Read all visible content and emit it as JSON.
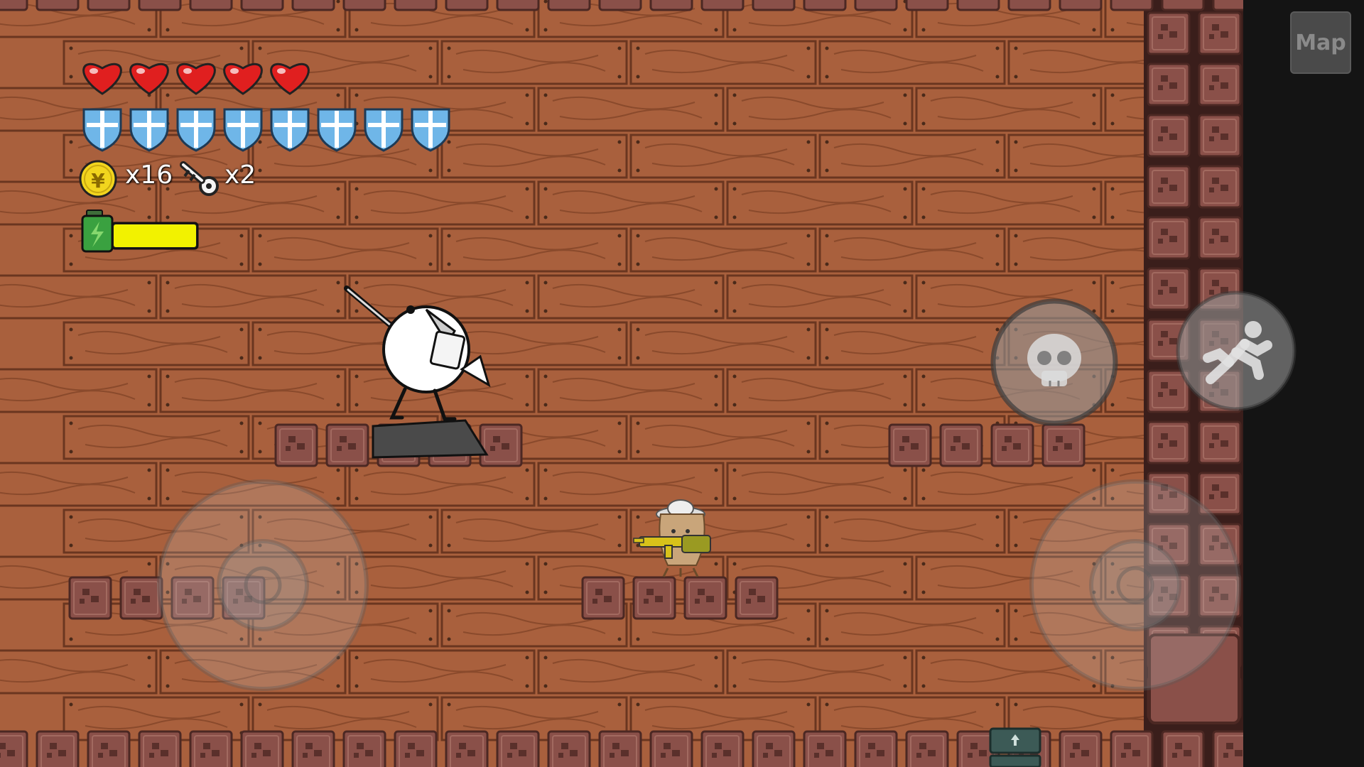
{
  "hud": {
    "hearts_filled": 5,
    "hearts_total": 5,
    "shields": 8,
    "coin_icon": "yen-coin-icon",
    "coin_count_label": "x16",
    "key_icon": "key-icon",
    "key_count_label": "x2",
    "energy_icon": "battery-icon",
    "energy_level": 1.0
  },
  "map_button": {
    "label": "Map"
  },
  "controls": {
    "skill_icon": "skull-icon",
    "dash_icon": "running-man-icon",
    "move_joystick": "left-joystick",
    "aim_joystick": "right-joystick"
  },
  "colors": {
    "wood": "#a9603d",
    "wood_dark": "#8a4a2c",
    "brick": "#8a5049",
    "brick_dark": "#5a302b",
    "heart": "#e01f1f",
    "shield": "#6fb6e8",
    "coin": "#f2d51e",
    "energy": "#f2f200",
    "background": "#141414"
  }
}
